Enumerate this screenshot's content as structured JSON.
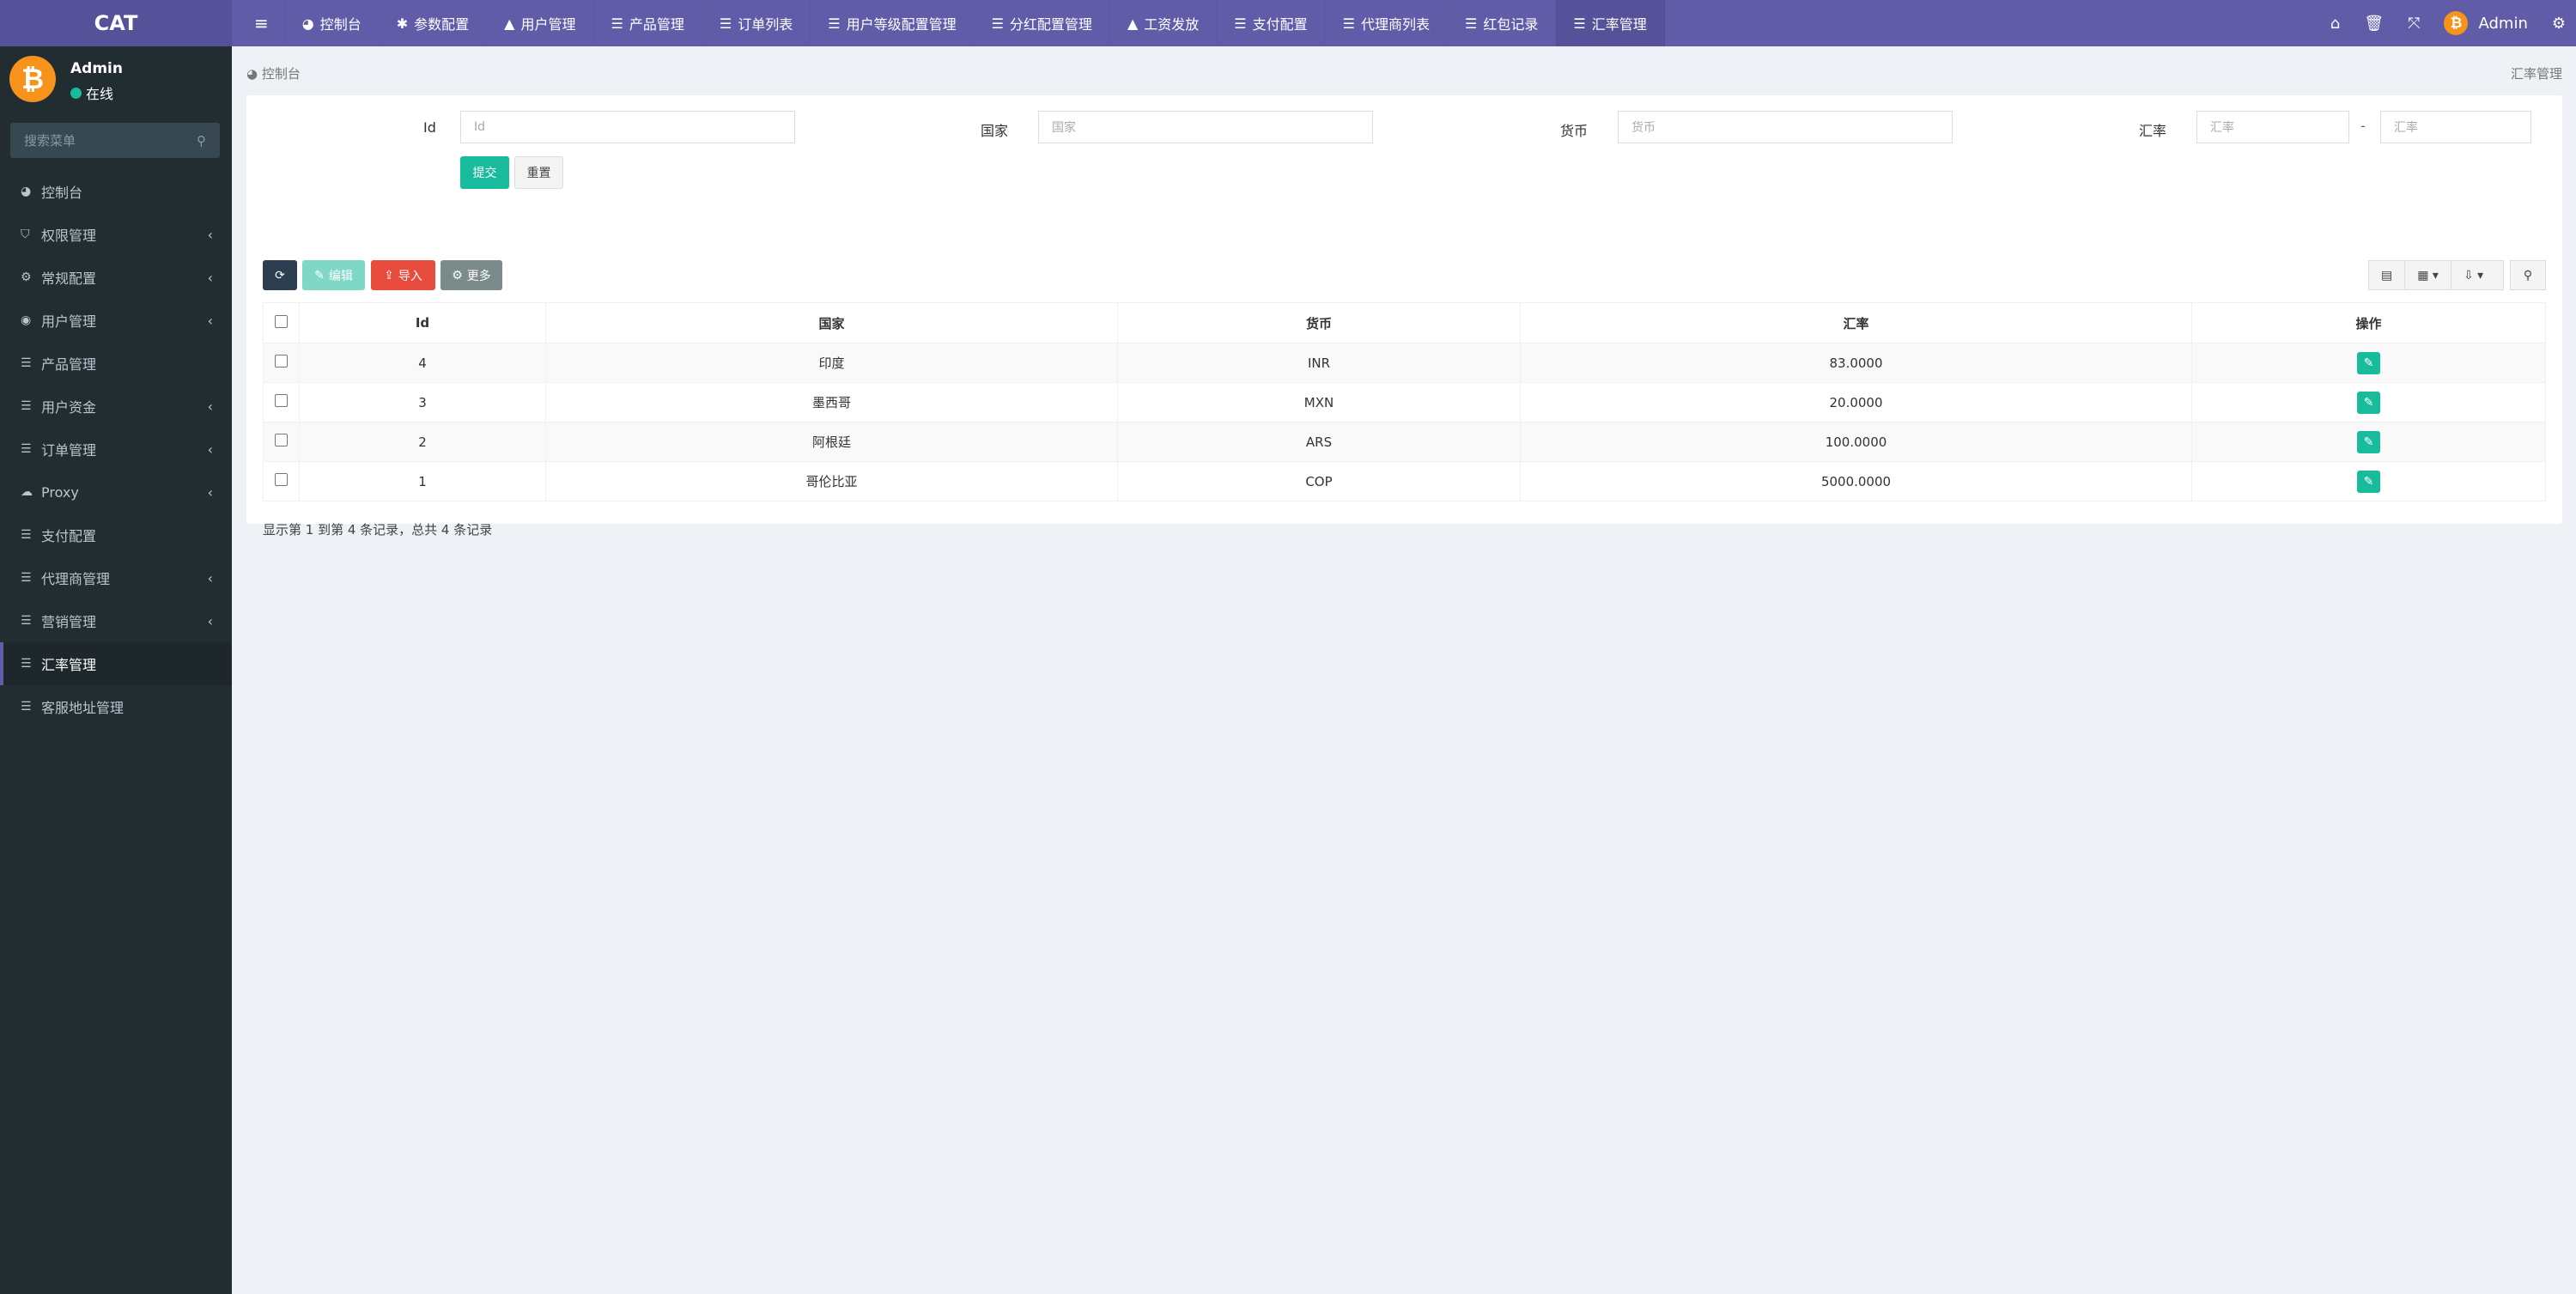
{
  "logo": "CAT",
  "nav": [
    {
      "icon": "dashboard-icon",
      "glyph": "◕",
      "label": "控制台"
    },
    {
      "icon": "gear-icon",
      "glyph": "✱",
      "label": "参数配置"
    },
    {
      "icon": "user-icon",
      "glyph": "▲",
      "label": "用户管理"
    },
    {
      "icon": "list-icon",
      "glyph": "☰",
      "label": "产品管理"
    },
    {
      "icon": "list-icon",
      "glyph": "☰",
      "label": "订单列表"
    },
    {
      "icon": "list-icon",
      "glyph": "☰",
      "label": "用户等级配置管理"
    },
    {
      "icon": "list-icon",
      "glyph": "☰",
      "label": "分红配置管理"
    },
    {
      "icon": "user-icon",
      "glyph": "▲",
      "label": "工资发放"
    },
    {
      "icon": "list-icon",
      "glyph": "☰",
      "label": "支付配置"
    },
    {
      "icon": "list-icon",
      "glyph": "☰",
      "label": "代理商列表"
    },
    {
      "icon": "list-icon",
      "glyph": "☰",
      "label": "红包记录"
    },
    {
      "icon": "list-icon",
      "glyph": "☰",
      "label": "汇率管理",
      "active": true
    }
  ],
  "header_right": {
    "user": "Admin"
  },
  "sidebar": {
    "user": "Admin",
    "status": "在线",
    "search_placeholder": "搜索菜单",
    "items": [
      {
        "icon": "dashboard-icon",
        "glyph": "◕",
        "label": "控制台",
        "sub": false
      },
      {
        "icon": "shield-icon",
        "glyph": "⛉",
        "label": "权限管理",
        "sub": true
      },
      {
        "icon": "gears-icon",
        "glyph": "⚙",
        "label": "常规配置",
        "sub": true
      },
      {
        "icon": "user-circle-icon",
        "glyph": "◉",
        "label": "用户管理",
        "sub": true
      },
      {
        "icon": "list-icon",
        "glyph": "☰",
        "label": "产品管理",
        "sub": false
      },
      {
        "icon": "list-icon",
        "glyph": "☰",
        "label": "用户资金",
        "sub": true
      },
      {
        "icon": "list-icon",
        "glyph": "☰",
        "label": "订单管理",
        "sub": true
      },
      {
        "icon": "cloud-icon",
        "glyph": "☁",
        "label": "Proxy",
        "sub": true
      },
      {
        "icon": "list-icon",
        "glyph": "☰",
        "label": "支付配置",
        "sub": false
      },
      {
        "icon": "list-icon",
        "glyph": "☰",
        "label": "代理商管理",
        "sub": true
      },
      {
        "icon": "list-icon",
        "glyph": "☰",
        "label": "营销管理",
        "sub": true
      },
      {
        "icon": "list-icon",
        "glyph": "☰",
        "label": "汇率管理",
        "sub": false,
        "active": true
      },
      {
        "icon": "list-icon",
        "glyph": "☰",
        "label": "客服地址管理",
        "sub": false
      }
    ]
  },
  "breadcrumb": {
    "home": "控制台",
    "current": "汇率管理"
  },
  "form": {
    "id_label": "Id",
    "id_placeholder": "Id",
    "country_label": "国家",
    "country_placeholder": "国家",
    "currency_label": "货币",
    "currency_placeholder": "货币",
    "rate_label": "汇率",
    "rate_min_placeholder": "汇率",
    "rate_sep": "-",
    "rate_max_placeholder": "汇率",
    "submit": "提交",
    "reset": "重置"
  },
  "toolbar": {
    "edit": "编辑",
    "import": "导入",
    "more": "更多"
  },
  "table": {
    "columns": [
      "Id",
      "国家",
      "货币",
      "汇率",
      "操作"
    ],
    "rows": [
      {
        "id": "4",
        "country": "印度",
        "currency": "INR",
        "rate": "83.0000"
      },
      {
        "id": "3",
        "country": "墨西哥",
        "currency": "MXN",
        "rate": "20.0000"
      },
      {
        "id": "2",
        "country": "阿根廷",
        "currency": "ARS",
        "rate": "100.0000"
      },
      {
        "id": "1",
        "country": "哥伦比亚",
        "currency": "COP",
        "rate": "5000.0000"
      }
    ]
  },
  "pagination_text": "显示第 1 到第 4 条记录，总共 4 条记录",
  "colors": {
    "header": "#605ca8",
    "sidebar": "#222d32",
    "success": "#18bc9c",
    "danger": "#e74c3c",
    "primary_dark": "#2c3e50",
    "muted": "#95a5a6"
  }
}
